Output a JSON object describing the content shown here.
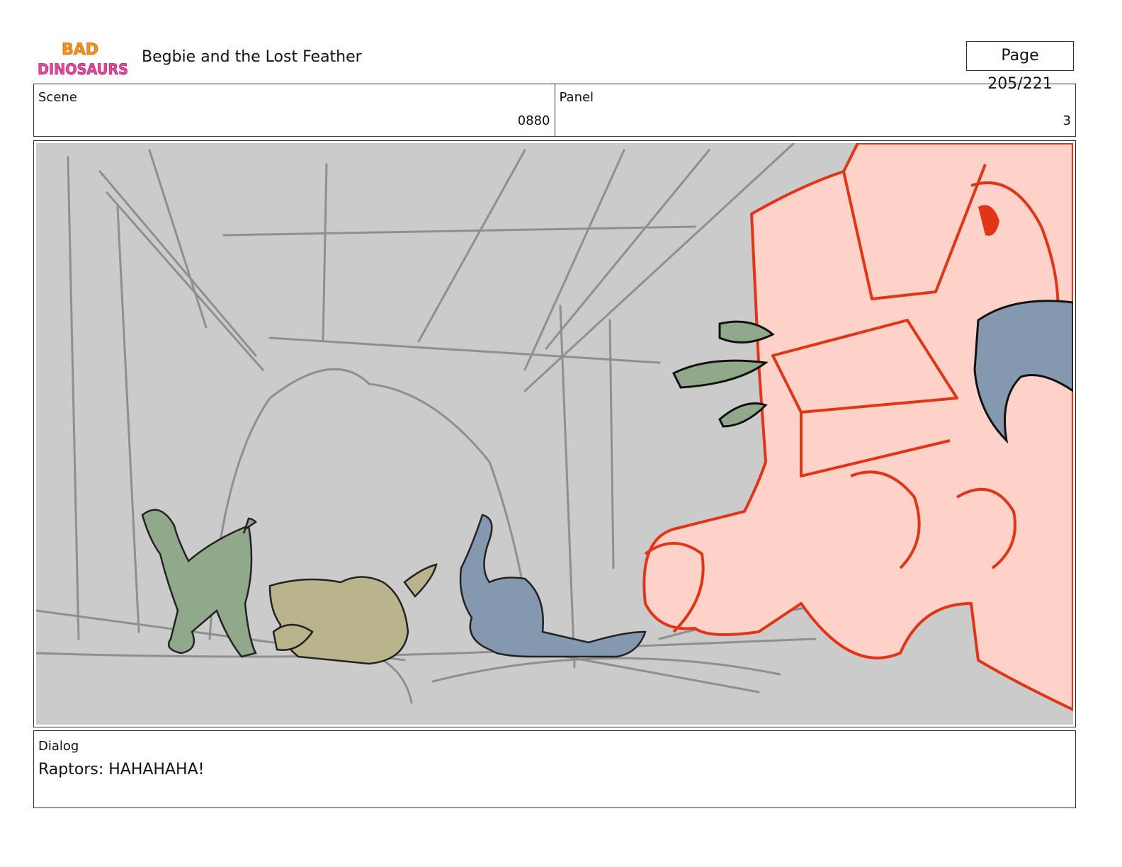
{
  "header": {
    "logo_text_top": "BAD",
    "logo_text_bottom": "DINOSAURS",
    "title": "Begbie and the Lost Feather",
    "page_label": "Page 205/221"
  },
  "info": {
    "scene_label": "Scene",
    "scene_value": "0880",
    "panel_label": "Panel",
    "panel_value": "3"
  },
  "dialog": {
    "label": "Dialog",
    "text": "Raptors: HAHAHAHA!"
  },
  "colors": {
    "background_sketch": "#cbcbcb",
    "foreground_character_fill": "#fdd2c9",
    "foreground_character_line": "#e03516",
    "raptor_green": "#8fa98a",
    "raptor_khaki": "#b9b48b",
    "raptor_blue": "#8498b0"
  }
}
